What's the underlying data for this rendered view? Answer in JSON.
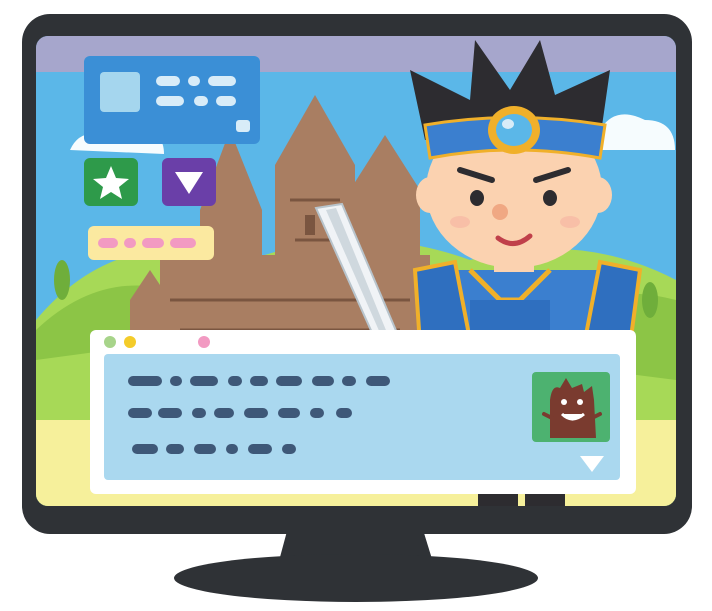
{
  "scene": {
    "colors": {
      "monitor_bezel": "#2f3236",
      "sky": "#5bb7e8",
      "sky_top_band": "#a6a6cc",
      "hill_green": "#a7d957",
      "hill_dark": "#6fae3b",
      "ground": "#f6f09b",
      "castle": "#a97e62",
      "castle_dark": "#7a5540",
      "status_panel": "#3b8fd6",
      "dialog_bg": "#a5d6ee",
      "dialog_frame": "#ffffff",
      "hero_armor": "#3b7fcf",
      "hero_trim": "#f0b02a",
      "hero_skin": "#fbd2b0",
      "hero_hair": "#2d2c30",
      "monster": "#7a3b2f"
    },
    "buttons": [
      {
        "icon": "star-icon",
        "color": "#2e9a4a"
      },
      {
        "icon": "triangle-down-icon",
        "color": "#6a3fa8"
      }
    ],
    "dialog": {
      "window_dots": [
        "#a7d48a",
        "#f4cc2a",
        "#f29ac2"
      ],
      "more_indicator": "triangle-down-icon"
    }
  }
}
